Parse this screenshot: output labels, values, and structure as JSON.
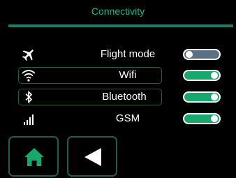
{
  "header": {
    "title": "Connectivity"
  },
  "settings": [
    {
      "label": "Flight mode",
      "icon": "airplane-icon",
      "enabled": false
    },
    {
      "label": "Wifi",
      "icon": "wifi-icon",
      "enabled": true
    },
    {
      "label": "Bluetooth",
      "icon": "bluetooth-icon",
      "enabled": true
    },
    {
      "label": "GSM",
      "icon": "signal-bars-icon",
      "enabled": true
    }
  ],
  "nav": {
    "home_icon": "home-icon",
    "back_icon": "back-arrow-icon"
  },
  "colors": {
    "accent": "#1fb58a",
    "toggle_on": "#18a86b",
    "toggle_off": "#5b7085",
    "border": "#1f5f50"
  }
}
